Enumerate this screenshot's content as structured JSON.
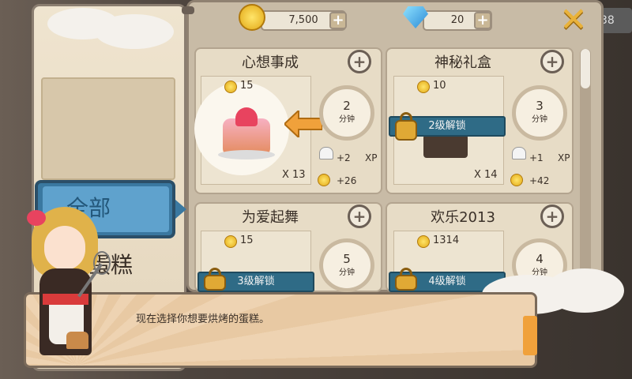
{
  "currency": {
    "coins": "7,500",
    "gems": "20",
    "plus_symbol": "+",
    "side_value": "38"
  },
  "close_symbol": "✕",
  "tabs": {
    "all_label": "全部",
    "cakes_label": "蛋糕"
  },
  "cards": [
    {
      "title": "心想事成",
      "price": "15",
      "minutes": "2",
      "unit": "分钟",
      "quantity": "X 13",
      "chef": "+2",
      "xp": "XP",
      "coins": "+26",
      "locked": false
    },
    {
      "title": "神秘礼盒",
      "price": "10",
      "minutes": "3",
      "unit": "分钟",
      "quantity": "X 14",
      "chef": "+1",
      "xp": "XP",
      "coins": "+42",
      "locked": true,
      "lock_label": "2级解锁"
    },
    {
      "title": "为爱起舞",
      "price": "15",
      "minutes": "5",
      "unit": "分钟",
      "locked": true,
      "lock_label": "3级解锁"
    },
    {
      "title": "欢乐2013",
      "price": "1314",
      "minutes": "4",
      "unit": "分钟",
      "locked": true,
      "lock_label": "4级解锁"
    }
  ],
  "zoom_symbol": "+",
  "dialog": {
    "text": "现在选择你想要烘烤的蛋糕。"
  },
  "colors": {
    "lock_bar": "#2f6b86",
    "tab_active": "#3a78a0",
    "accent_orange": "#f0a13b"
  }
}
